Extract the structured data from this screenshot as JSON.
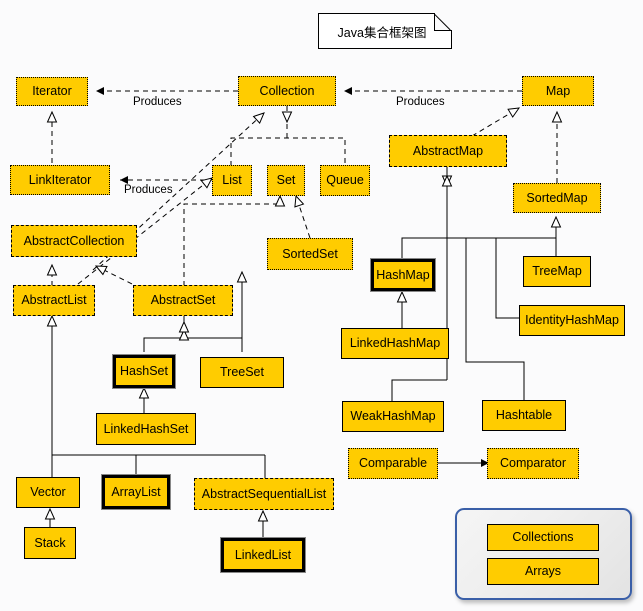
{
  "diagram": {
    "title_note": "Java集合框架图",
    "background_color": "#fbfbfc",
    "node_fill_color": "#FFCC00",
    "panel_border_color": "#3A5FA8",
    "edge_labels": [
      {
        "id": "produces_top",
        "text": "Produces"
      },
      {
        "id": "produces_right",
        "text": "Produces"
      },
      {
        "id": "produces_left",
        "text": "Produces"
      }
    ],
    "nodes": {
      "iterator": "Iterator",
      "collection": "Collection",
      "map": "Map",
      "link_iterator": "LinkIterator",
      "list": "List",
      "set": "Set",
      "queue": "Queue",
      "abstract_map": "AbstractMap",
      "sorted_map": "SortedMap",
      "abstract_collection": "AbstractCollection",
      "sorted_set": "SortedSet",
      "hash_map": "HashMap",
      "tree_map": "TreeMap",
      "abstract_list": "AbstractList",
      "abstract_set": "AbstractSet",
      "identity_hash_map": "IdentityHashMap",
      "linked_hash_map": "LinkedHashMap",
      "hash_set": "HashSet",
      "tree_set": "TreeSet",
      "linked_hash_set": "LinkedHashSet",
      "weak_hash_map": "WeakHashMap",
      "hashtable": "Hashtable",
      "comparable": "Comparable",
      "comparator": "Comparator",
      "vector": "Vector",
      "array_list": "ArrayList",
      "abstract_sequential_list": "AbstractSequentialList",
      "stack": "Stack",
      "linked_list": "LinkedList",
      "collections": "Collections",
      "arrays": "Arrays"
    }
  }
}
